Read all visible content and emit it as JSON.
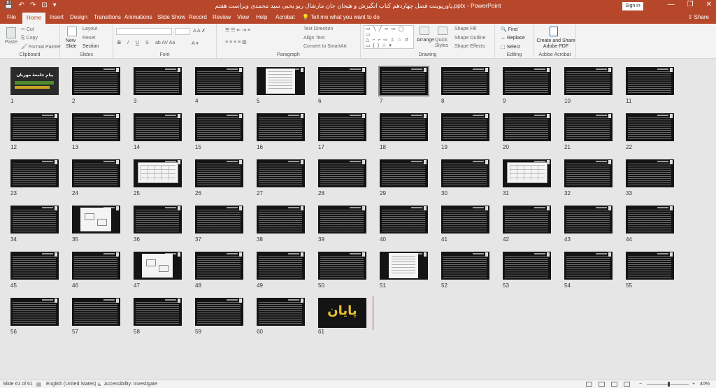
{
  "titlebar": {
    "title": "پاورپوینت فصل چهاردهم کتاب انگیزش و هیجان جان مارشال ریو یحیی سید محمدی ویراست هفتم.pptx - PowerPoint",
    "signin": "Sign in",
    "minimize": "—",
    "restore": "❐",
    "close": "✕",
    "qat": [
      "💾",
      "↶",
      "↷",
      "⊡",
      "▾"
    ]
  },
  "tabs": [
    "File",
    "Home",
    "Insert",
    "Design",
    "Transitions",
    "Animations",
    "Slide Show",
    "Record",
    "Review",
    "View",
    "Help",
    "Acrobat"
  ],
  "active_tab": "Home",
  "tell_me": "Tell me what you want to do",
  "share": "Share",
  "ribbon": {
    "clipboard": {
      "label": "Clipboard",
      "paste": "Paste",
      "cut": "Cut",
      "copy": "Copy",
      "format_painter": "Format Painter"
    },
    "slides": {
      "label": "Slides",
      "new_slide": "New Slide",
      "layout": "Layout",
      "reset": "Reset",
      "section": "Section"
    },
    "font": {
      "label": "Font"
    },
    "paragraph": {
      "label": "Paragraph",
      "text_direction": "Text Direction",
      "align_text": "Align Text",
      "smartart": "Convert to SmartArt"
    },
    "drawing": {
      "label": "Drawing",
      "arrange": "Arrange",
      "quick_styles": "Quick Styles",
      "shape_fill": "Shape Fill",
      "shape_outline": "Shape Outline",
      "shape_effects": "Shape Effects"
    },
    "editing": {
      "label": "Editing",
      "find": "Find",
      "replace": "Replace",
      "select": "Select"
    },
    "acrobat": {
      "label": "Adobe Acrobat",
      "create_share": "Create and Share Adobe PDF"
    }
  },
  "slides": {
    "title_slide_text": "پیام جامعۀ مهربان",
    "end_slide_text": "پایان",
    "numbers": [
      "1",
      "2",
      "3",
      "4",
      "5",
      "6",
      "7",
      "8",
      "9",
      "10",
      "11",
      "12",
      "13",
      "14",
      "15",
      "16",
      "17",
      "18",
      "19",
      "20",
      "21",
      "22",
      "23",
      "24",
      "25",
      "26",
      "27",
      "28",
      "29",
      "30",
      "31",
      "32",
      "33",
      "34",
      "35",
      "36",
      "37",
      "38",
      "39",
      "40",
      "41",
      "42",
      "43",
      "44",
      "45",
      "46",
      "47",
      "48",
      "49",
      "50",
      "51",
      "52",
      "53",
      "54",
      "55",
      "56",
      "57",
      "58",
      "59",
      "60",
      "61"
    ]
  },
  "status": {
    "slide_count": "Slide 61 of 61",
    "language": "English (United States)",
    "accessibility": "Accessibility: Investigate",
    "zoom": "40%"
  }
}
